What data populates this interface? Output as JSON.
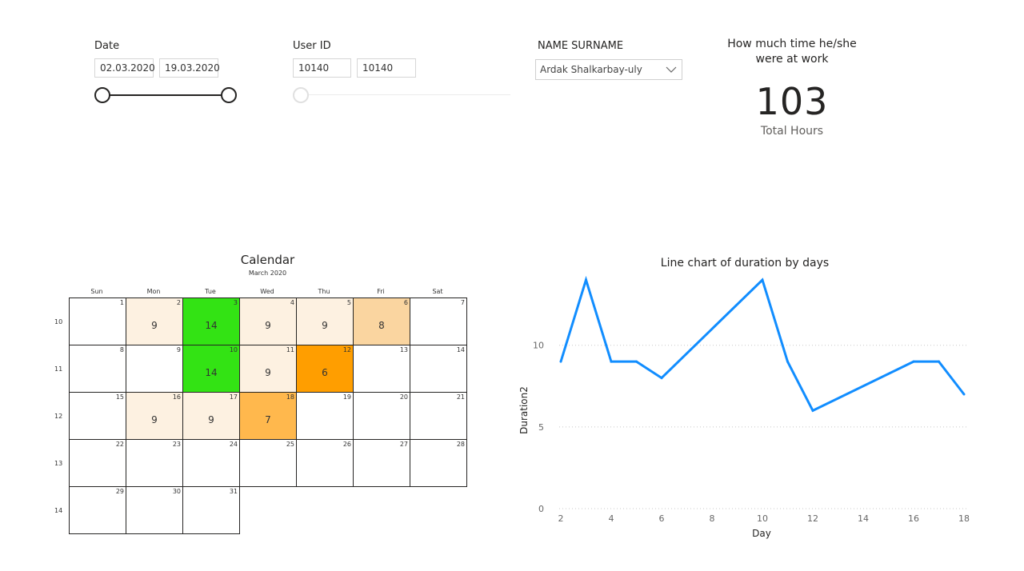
{
  "filters": {
    "date": {
      "label": "Date",
      "from": "02.03.2020",
      "to": "19.03.2020"
    },
    "user_id": {
      "label": "User ID",
      "from": "10140",
      "to": "10140"
    },
    "name": {
      "label": "NAME SURNAME",
      "selected": "Ardak Shalkarbay-uly"
    }
  },
  "kpi": {
    "title_line1": "How much time he/she",
    "title_line2": "were at work",
    "value": "103",
    "caption": "Total Hours"
  },
  "calendar": {
    "title": "Calendar",
    "month": "March 2020",
    "weekdays": [
      "Sun",
      "Mon",
      "Tue",
      "Wed",
      "Thu",
      "Fri",
      "Sat"
    ],
    "week_numbers": [
      "10",
      "11",
      "12",
      "13",
      "14"
    ],
    "weeks": [
      [
        {
          "d": "1",
          "h": ""
        },
        {
          "d": "2",
          "h": "9",
          "c": "#fdf1e1"
        },
        {
          "d": "3",
          "h": "14",
          "c": "#33e314"
        },
        {
          "d": "4",
          "h": "9",
          "c": "#fdf1e1"
        },
        {
          "d": "5",
          "h": "9",
          "c": "#fdf1e1"
        },
        {
          "d": "6",
          "h": "8",
          "c": "#fad5a0"
        },
        {
          "d": "7",
          "h": ""
        }
      ],
      [
        {
          "d": "8",
          "h": ""
        },
        {
          "d": "9",
          "h": ""
        },
        {
          "d": "10",
          "h": "14",
          "c": "#33e314"
        },
        {
          "d": "11",
          "h": "9",
          "c": "#fdf1e1"
        },
        {
          "d": "12",
          "h": "6",
          "c": "#ff9e00"
        },
        {
          "d": "13",
          "h": ""
        },
        {
          "d": "14",
          "h": ""
        }
      ],
      [
        {
          "d": "15",
          "h": ""
        },
        {
          "d": "16",
          "h": "9",
          "c": "#fdf1e1"
        },
        {
          "d": "17",
          "h": "9",
          "c": "#fdf1e1"
        },
        {
          "d": "18",
          "h": "7",
          "c": "#ffb84d"
        },
        {
          "d": "19",
          "h": ""
        },
        {
          "d": "20",
          "h": ""
        },
        {
          "d": "21",
          "h": ""
        }
      ],
      [
        {
          "d": "22",
          "h": ""
        },
        {
          "d": "23",
          "h": ""
        },
        {
          "d": "24",
          "h": ""
        },
        {
          "d": "25",
          "h": ""
        },
        {
          "d": "26",
          "h": ""
        },
        {
          "d": "27",
          "h": ""
        },
        {
          "d": "28",
          "h": ""
        }
      ],
      [
        {
          "d": "29",
          "h": ""
        },
        {
          "d": "30",
          "h": ""
        },
        {
          "d": "31",
          "h": ""
        }
      ]
    ]
  },
  "chart_data": {
    "type": "line",
    "title": "Line chart of duration by days",
    "xlabel": "Day",
    "ylabel": "Duration2",
    "x": [
      2,
      3,
      4,
      5,
      6,
      10,
      11,
      12,
      16,
      17,
      18
    ],
    "series": [
      {
        "values": [
          9,
          14,
          9,
          9,
          8,
          14,
          9,
          6,
          9,
          9,
          7
        ]
      }
    ],
    "xticks": [
      2,
      4,
      6,
      8,
      10,
      12,
      14,
      16,
      18
    ],
    "yticks": [
      0,
      5,
      10
    ],
    "xlim": [
      2,
      18
    ],
    "ylim": [
      0,
      14
    ],
    "line_color": "#118dff",
    "grid": "horizontal dotted"
  }
}
